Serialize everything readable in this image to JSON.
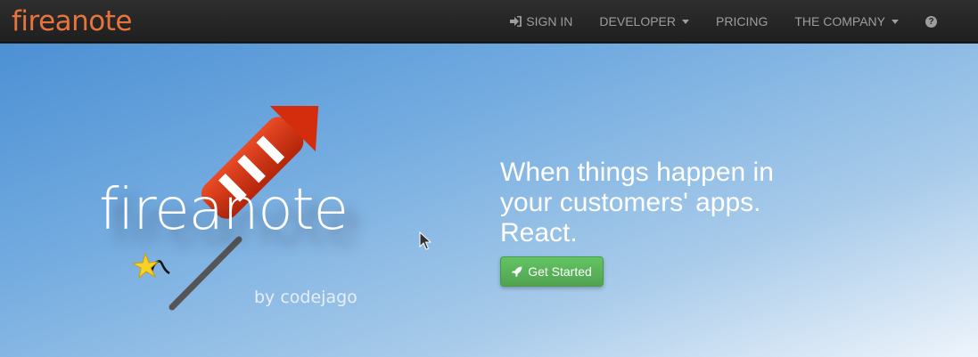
{
  "brand": {
    "name": "fireanote",
    "color": "#e8743c"
  },
  "nav": {
    "sign_in": "SIGN IN",
    "developer": "DEVELOPER",
    "pricing": "PRICING",
    "company": "THE COMPANY",
    "help_icon": "question-circle-icon",
    "sign_in_icon": "sign-in-icon"
  },
  "hero": {
    "logo_text": "fireanote",
    "byline": "by codejago",
    "headline": "When things happen in your customers' apps. React.",
    "cta_label": "Get Started",
    "cta_icon": "rocket-icon",
    "cta_color": "#5cb85c"
  }
}
